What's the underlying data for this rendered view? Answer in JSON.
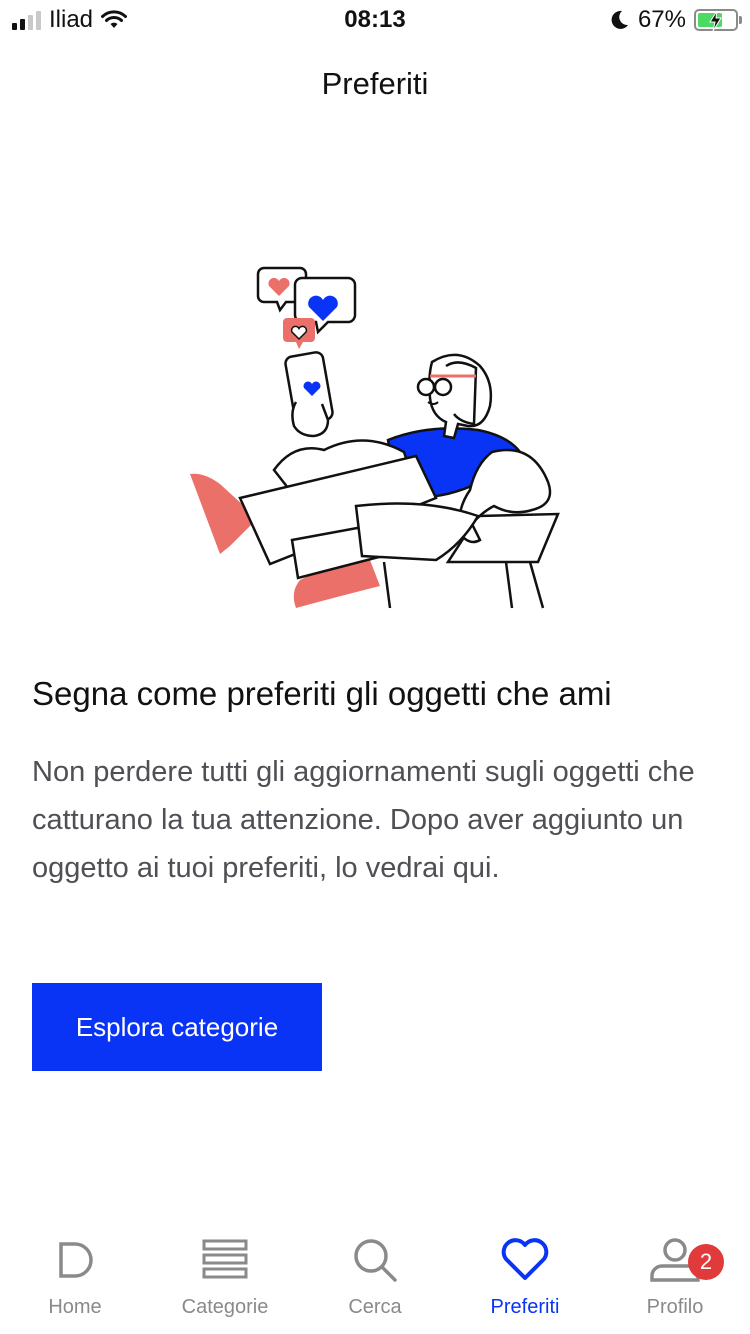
{
  "status_bar": {
    "carrier": "Iliad",
    "time": "08:13",
    "battery": "67%",
    "battery_level": 0.67,
    "battery_color": "#4cd964"
  },
  "header": {
    "title": "Preferiti"
  },
  "empty_state": {
    "heading": "Segna come preferiti gli oggetti che ami",
    "body": "Non perdere tutti gli aggiornamenti sugli oggetti che catturano la tua attenzione. Dopo aver aggiunto un oggetto ai tuoi preferiti, lo vedrai qui.",
    "cta_label": "Esplora categorie"
  },
  "tab_bar": {
    "items": [
      {
        "label": "Home",
        "icon": "home-icon",
        "active": false
      },
      {
        "label": "Categorie",
        "icon": "categories-icon",
        "active": false
      },
      {
        "label": "Cerca",
        "icon": "search-icon",
        "active": false
      },
      {
        "label": "Preferiti",
        "icon": "heart-icon",
        "active": true
      },
      {
        "label": "Profilo",
        "icon": "profile-icon",
        "active": false,
        "badge": "2"
      }
    ]
  },
  "colors": {
    "accent": "#0a34f5",
    "illustration_red": "#ec706a",
    "badge": "#e03a3a",
    "inactive": "#8a8a8a"
  }
}
